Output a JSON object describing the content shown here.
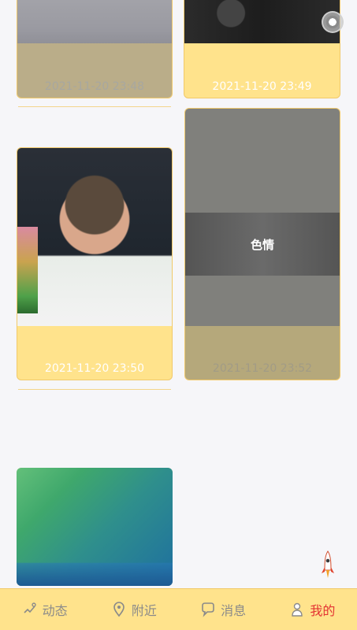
{
  "posts": [
    {
      "time": "2021-11-20 23:48"
    },
    {
      "time": "2021-11-20 23:49"
    },
    {
      "time": "2021-11-20 23:50"
    },
    {
      "time": "2021-11-20 23:52",
      "blocked_label": "色情"
    },
    {}
  ],
  "tabbar": {
    "items": [
      {
        "label": "动态",
        "icon": "moments-icon"
      },
      {
        "label": "附近",
        "icon": "location-pin-icon"
      },
      {
        "label": "消息",
        "icon": "message-bubble-icon"
      },
      {
        "label": "我的",
        "icon": "user-icon",
        "active": true
      }
    ]
  },
  "colors": {
    "accent_bg": "#ffe38c",
    "active_tab": "#e33333",
    "inactive_tab": "#8a8a8a"
  },
  "misc": {
    "settings_icon": "gear-icon",
    "rocket_icon": "rocket-icon"
  }
}
